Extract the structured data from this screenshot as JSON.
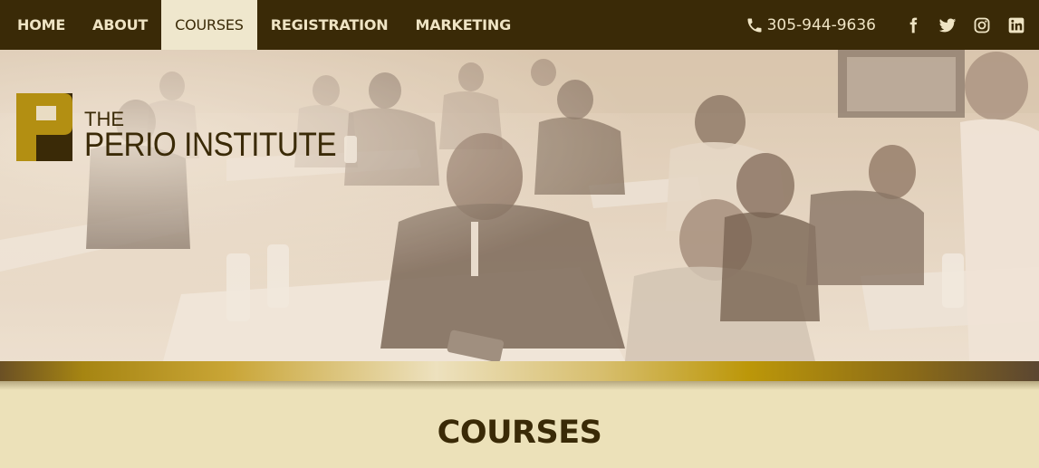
{
  "nav": {
    "items": [
      {
        "label": "HOME",
        "active": false
      },
      {
        "label": "ABOUT",
        "active": false
      },
      {
        "label": "COURSES",
        "active": true
      },
      {
        "label": "REGISTRATION",
        "active": false
      },
      {
        "label": "MARKETING",
        "active": false
      }
    ],
    "phone": "305-944-9636",
    "social_icons": [
      "facebook-icon",
      "twitter-icon",
      "instagram-icon",
      "linkedin-icon"
    ]
  },
  "logo": {
    "line1": "THE",
    "line2": "PERIO INSTITUTE"
  },
  "page": {
    "heading": "COURSES"
  },
  "colors": {
    "nav_bg": "#3a2a07",
    "nav_text": "#efe4c4",
    "active_tab_bg": "#efe7cd",
    "gold": "#bc9709",
    "page_bg": "#ece1b9",
    "brand_dark": "#3a2a07"
  }
}
